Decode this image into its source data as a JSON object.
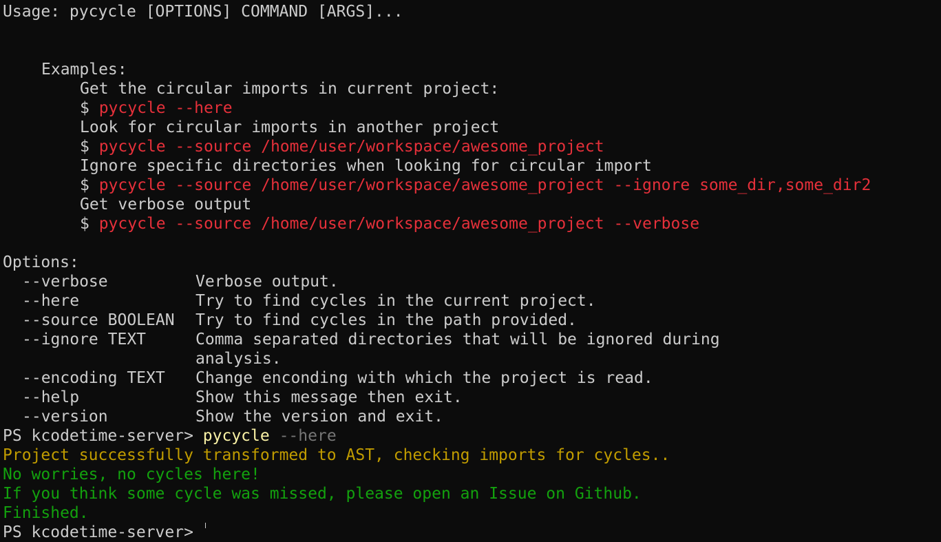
{
  "terminal": {
    "usage": "Usage: pycycle [OPTIONS] COMMAND [ARGS]...",
    "examples_header": "Examples:",
    "examples": [
      {
        "desc": "Get the circular imports in current project:",
        "prompt": "$ ",
        "cmd": "pycycle --here"
      },
      {
        "desc": "Look for circular imports in another project",
        "prompt": "$ ",
        "cmd": "pycycle --source /home/user/workspace/awesome_project"
      },
      {
        "desc": "Ignore specific directories when looking for circular import",
        "prompt": "$ ",
        "cmd": "pycycle --source /home/user/workspace/awesome_project --ignore some_dir,some_dir2"
      },
      {
        "desc": "Get verbose output",
        "prompt": "$ ",
        "cmd": "pycycle --source /home/user/workspace/awesome_project --verbose"
      }
    ],
    "options_header": "Options:",
    "options": [
      {
        "flag": "--verbose",
        "desc": "Verbose output."
      },
      {
        "flag": "--here",
        "desc": "Try to find cycles in the current project."
      },
      {
        "flag": "--source BOOLEAN",
        "desc": "Try to find cycles in the path provided."
      },
      {
        "flag": "--ignore TEXT",
        "desc": "Comma separated directories that will be ignored during",
        "desc_cont": "analysis."
      },
      {
        "flag": "--encoding TEXT",
        "desc": "Change enconding with which the project is read."
      },
      {
        "flag": "--help",
        "desc": "Show this message then exit."
      },
      {
        "flag": "--version",
        "desc": "Show the version and exit."
      }
    ],
    "prompt": {
      "text": "PS kcodetime-server> ",
      "command": "pycycle",
      "args": " --here"
    },
    "output": {
      "transform": "Project successfully transformed to AST, checking imports for cycles..",
      "no_worries": "No worries, no cycles here!",
      "issue": "If you think some cycle was missed, please open an Issue on Github.",
      "finished": "Finished."
    },
    "next_prompt": "PS kcodetime-server> "
  },
  "colors": {
    "background": "#0c0c0c",
    "foreground": "#cccccc",
    "red": "#e5303a",
    "yellow": "#c19c00",
    "green": "#13a10e",
    "command": "#f9f1a5",
    "argument": "#767676"
  }
}
